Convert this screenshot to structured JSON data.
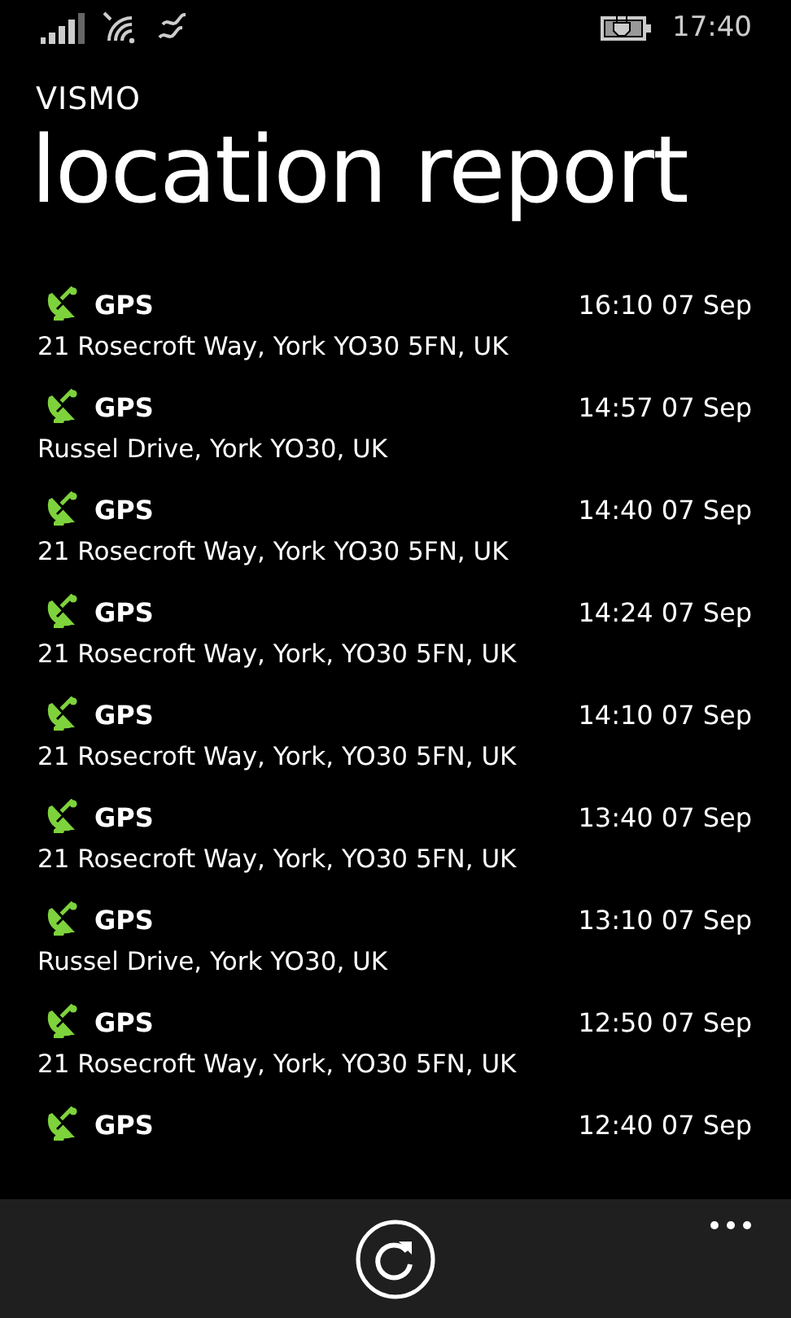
{
  "status_bar": {
    "time": "17:40"
  },
  "app": {
    "name": "VISMO",
    "title": "location report"
  },
  "reports": [
    {
      "source": "GPS",
      "time": "16:10 07 Sep",
      "address": "21 Rosecroft Way, York YO30 5FN, UK"
    },
    {
      "source": "GPS",
      "time": "14:57 07 Sep",
      "address": "Russel Drive, York YO30, UK"
    },
    {
      "source": "GPS",
      "time": "14:40 07 Sep",
      "address": "21 Rosecroft Way, York YO30 5FN, UK"
    },
    {
      "source": "GPS",
      "time": "14:24 07 Sep",
      "address": "21 Rosecroft Way, York, YO30 5FN, UK"
    },
    {
      "source": "GPS",
      "time": "14:10 07 Sep",
      "address": "21 Rosecroft Way, York, YO30 5FN, UK"
    },
    {
      "source": "GPS",
      "time": "13:40 07 Sep",
      "address": "21 Rosecroft Way, York, YO30 5FN, UK"
    },
    {
      "source": "GPS",
      "time": "13:10 07 Sep",
      "address": "Russel Drive, York YO30, UK"
    },
    {
      "source": "GPS",
      "time": "12:50 07 Sep",
      "address": "21 Rosecroft Way, York, YO30 5FN, UK"
    },
    {
      "source": "GPS",
      "time": "12:40 07 Sep"
    }
  ]
}
